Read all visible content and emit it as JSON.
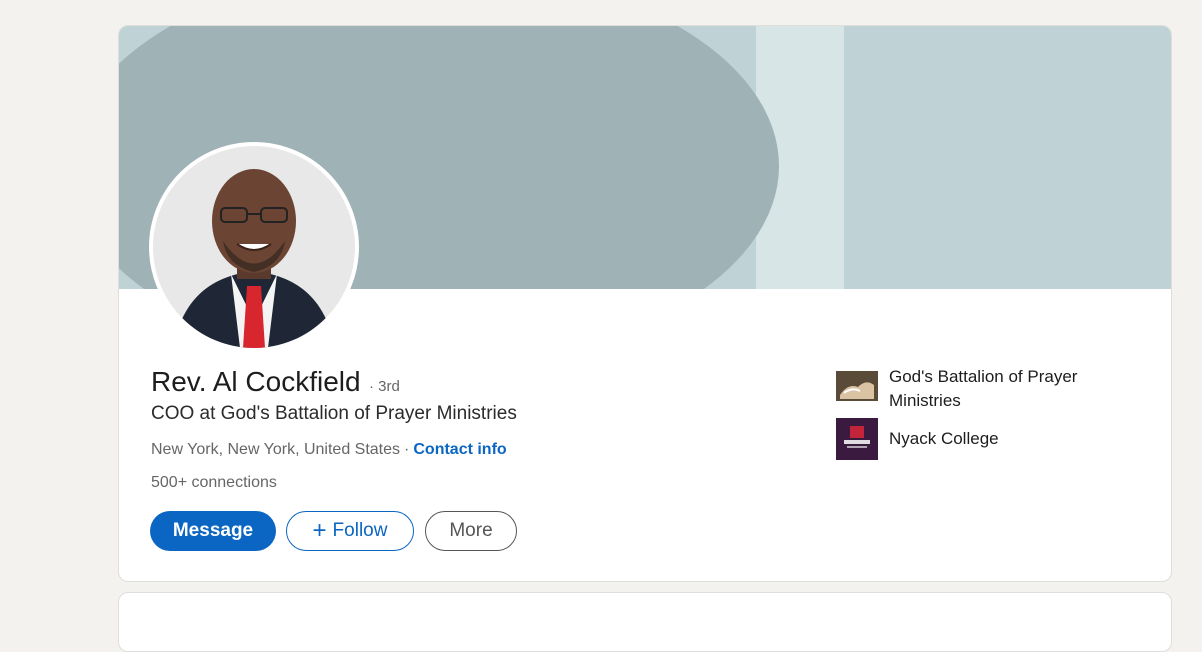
{
  "profile": {
    "name": "Rev. Al Cockfield",
    "degree": "· 3rd",
    "headline": "COO at God's Battalion of Prayer Ministries",
    "location": "New York, New York, United States",
    "separator": "·",
    "contact_info": "Contact info",
    "connections": "500+ connections"
  },
  "actions": {
    "message": "Message",
    "follow_plus": "+",
    "follow": "Follow",
    "more": "More"
  },
  "organizations": [
    {
      "name": "God's Battalion of Prayer Ministries",
      "logo": "praying-hands-photo"
    },
    {
      "name": "Nyack College",
      "logo": "alliance-university-logo"
    }
  ],
  "colors": {
    "accent": "#0a66c2",
    "page_bg": "#f3f2ef",
    "banner_light": "#bfd3d6",
    "banner_dark": "#9fb2b5"
  }
}
